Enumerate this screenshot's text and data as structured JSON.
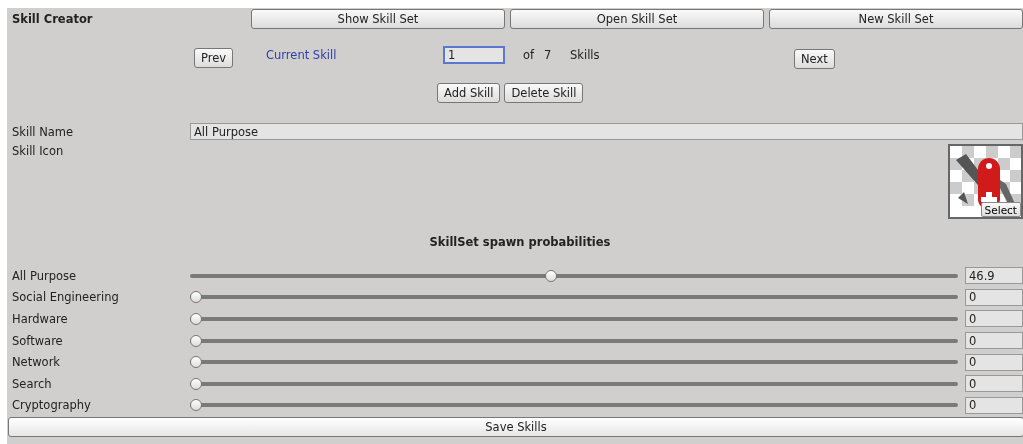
{
  "title": "Skill Creator",
  "header_buttons": [
    "Show Skill Set",
    "Open Skill Set",
    "New Skill Set"
  ],
  "navigation": {
    "prev": "Prev",
    "current_label": "Current Skill",
    "current_value": "1",
    "of": "of",
    "total": "7",
    "unit": "Skills",
    "next": "Next"
  },
  "skill_buttons": [
    "Add Skill",
    "Delete Skill"
  ],
  "skill_name": {
    "label": "Skill Name",
    "value": "All Purpose"
  },
  "skill_icon": {
    "label": "Skill Icon",
    "select": "Select"
  },
  "probabilities_title": "SkillSet spawn probabilities",
  "probabilities": [
    {
      "name": "All Purpose",
      "level": 0.469,
      "value": "46.9"
    },
    {
      "name": "Social Engineering",
      "level": 0,
      "value": "0"
    },
    {
      "name": "Hardware",
      "level": 0,
      "value": "0"
    },
    {
      "name": "Software",
      "level": 0,
      "value": "0"
    },
    {
      "name": "Network",
      "level": 0,
      "value": "0"
    },
    {
      "name": "Search",
      "level": 0,
      "value": "0"
    },
    {
      "name": "Cryptography",
      "level": 0,
      "value": "0"
    }
  ],
  "save_button": "Save Skills"
}
